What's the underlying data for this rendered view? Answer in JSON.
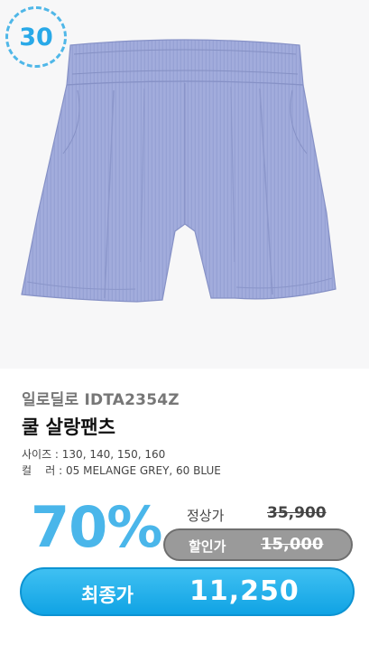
{
  "badge": {
    "number": "30"
  },
  "product": {
    "brand_code": "일로딜로 IDTA2354Z",
    "name": "쿨 살랑팬츠",
    "sizes": "사이즈 : 130, 140, 150, 160",
    "colors": "컬    러 : 05 MELANGE GREY, 60 BLUE"
  },
  "pricing": {
    "discount": "70%",
    "regular_label": "정상가",
    "regular_price": "35,900",
    "sale_label": "할인가",
    "sale_price": "15,000",
    "final_label": "최종가",
    "final_price": "11,250"
  },
  "colors": {
    "accent": "#29a9e8",
    "fabric": "#9aa6d8",
    "sale_pill": "#9a9a9a"
  },
  "icons": {
    "product_image": "shorts-photo"
  }
}
